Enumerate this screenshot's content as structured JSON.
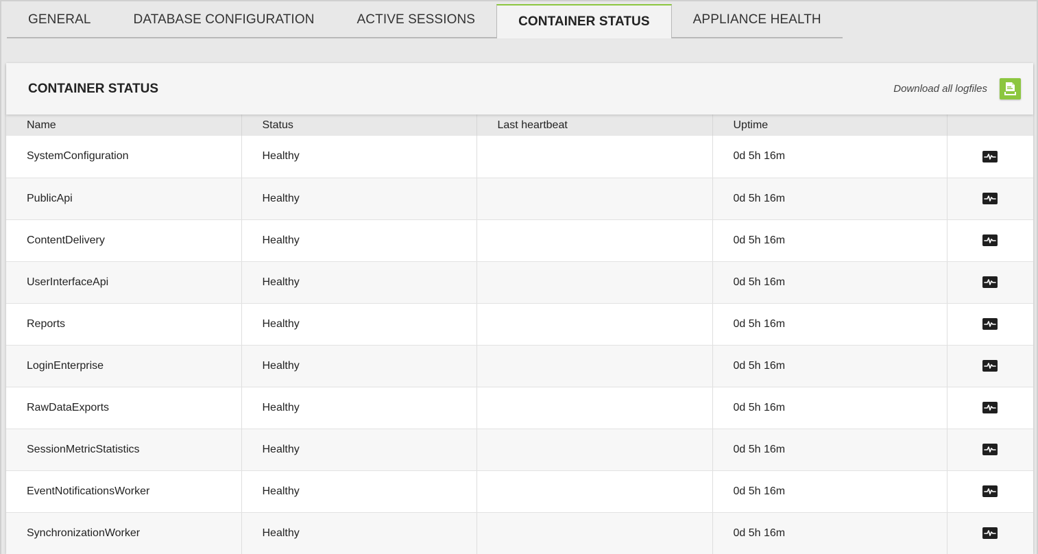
{
  "tabs": [
    {
      "label": "GENERAL",
      "active": false
    },
    {
      "label": "DATABASE CONFIGURATION",
      "active": false
    },
    {
      "label": "ACTIVE SESSIONS",
      "active": false
    },
    {
      "label": "CONTAINER STATUS",
      "active": true
    },
    {
      "label": "APPLIANCE HEALTH",
      "active": false
    }
  ],
  "card": {
    "title": "CONTAINER STATUS",
    "download_label": "Download all logfiles",
    "download_icon": "download-file-icon",
    "accent_color": "#8cc63f"
  },
  "table": {
    "columns": [
      "Name",
      "Status",
      "Last heartbeat",
      "Uptime",
      ""
    ],
    "row_icon": "heartbeat-icon",
    "rows": [
      {
        "name": "SystemConfiguration",
        "status": "Healthy",
        "heartbeat": "",
        "uptime": "0d 5h 16m"
      },
      {
        "name": "PublicApi",
        "status": "Healthy",
        "heartbeat": "",
        "uptime": "0d 5h 16m"
      },
      {
        "name": "ContentDelivery",
        "status": "Healthy",
        "heartbeat": "",
        "uptime": "0d 5h 16m"
      },
      {
        "name": "UserInterfaceApi",
        "status": "Healthy",
        "heartbeat": "",
        "uptime": "0d 5h 16m"
      },
      {
        "name": "Reports",
        "status": "Healthy",
        "heartbeat": "",
        "uptime": "0d 5h 16m"
      },
      {
        "name": "LoginEnterprise",
        "status": "Healthy",
        "heartbeat": "",
        "uptime": "0d 5h 16m"
      },
      {
        "name": "RawDataExports",
        "status": "Healthy",
        "heartbeat": "",
        "uptime": "0d 5h 16m"
      },
      {
        "name": "SessionMetricStatistics",
        "status": "Healthy",
        "heartbeat": "",
        "uptime": "0d 5h 16m"
      },
      {
        "name": "EventNotificationsWorker",
        "status": "Healthy",
        "heartbeat": "",
        "uptime": "0d 5h 16m"
      },
      {
        "name": "SynchronizationWorker",
        "status": "Healthy",
        "heartbeat": "",
        "uptime": "0d 5h 16m"
      }
    ]
  }
}
